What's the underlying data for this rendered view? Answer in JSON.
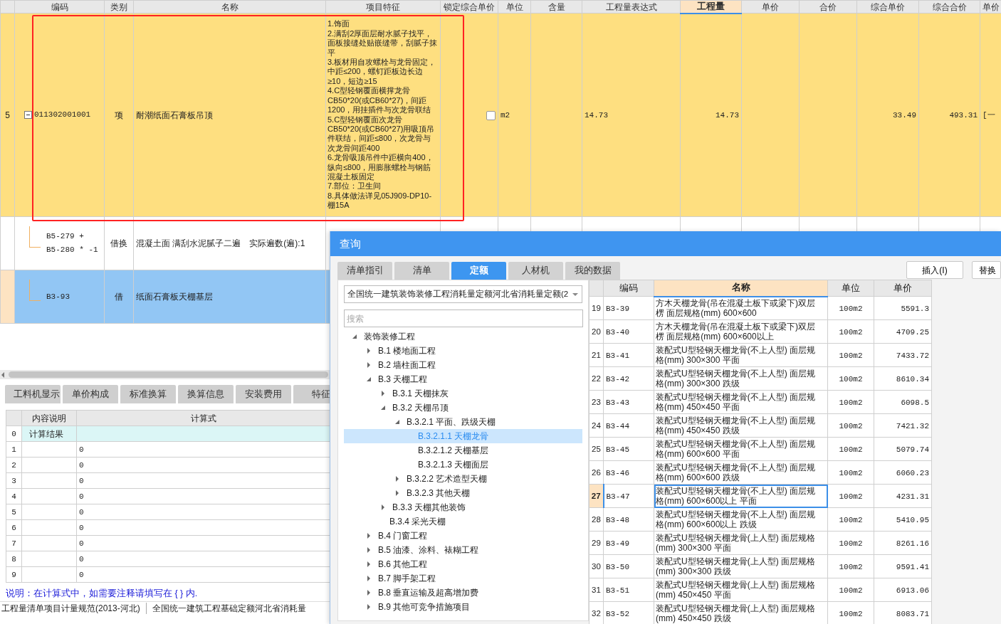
{
  "grid": {
    "columns": [
      {
        "label": "编码",
        "selected": false
      },
      {
        "label": "类别",
        "selected": false
      },
      {
        "label": "名称",
        "selected": false
      },
      {
        "label": "项目特征",
        "selected": false
      },
      {
        "label": "锁定综合单价",
        "selected": false
      },
      {
        "label": "单位",
        "selected": false
      },
      {
        "label": "含量",
        "selected": false
      },
      {
        "label": "工程量表达式",
        "selected": false
      },
      {
        "label": "工程量",
        "selected": true
      },
      {
        "label": "单价",
        "selected": false
      },
      {
        "label": "合价",
        "selected": false
      },
      {
        "label": "综合单价",
        "selected": false
      },
      {
        "label": "综合合价",
        "selected": false
      },
      {
        "label": "单价",
        "selected": false
      }
    ],
    "rows": [
      {
        "kind": "bill",
        "row_number": "5",
        "expanded": true,
        "selected": false,
        "code": [
          "011302001001"
        ],
        "category": "项",
        "name": "耐潮纸面石膏板吊顶",
        "features": [
          "1.饰面",
          "2.满刮2厚面层耐水腻子找平，面板接缝处贴嵌缝带，刮腻子抹平",
          "3.板材用自攻螺栓与龙骨固定，中距≤200，螺钉距板边长边≥10，短边≥15",
          "4.C型轻钢覆面横撑龙骨CB50*20(或CB60*27)，间距1200，用挂插件与次龙骨联结",
          "5.C型轻钢覆面次龙骨CB50*20(或CB60*27)用吸顶吊件联结，间距≤800，次龙骨与次龙骨间距400",
          "6.龙骨吸顶吊件中距横向400，纵向≤800，用膨胀螺栓与钢筋混凝土板固定",
          "7.部位：卫生间",
          "8.具体做法详见05J909-DP10-棚15A"
        ],
        "locked": false,
        "unit": "m2",
        "expression": "14.73",
        "quantity": "14.73",
        "comp_unit_price": "33.49",
        "comp_total": "493.31",
        "column_15": "[一"
      },
      {
        "kind": "quota",
        "selected": false,
        "code": [
          "B5-279 +",
          "B5-280 * -1"
        ],
        "category": "借换",
        "name": "混凝土面 满刮水泥腻子二遍　实际遍数(遍):1"
      },
      {
        "kind": "quota",
        "selected": true,
        "code": [
          "B3-93"
        ],
        "category": "借",
        "name": "纸面石膏板天棚基层"
      }
    ]
  },
  "bottom_tabs": [
    {
      "label": "工料机显示"
    },
    {
      "label": "单价构成"
    },
    {
      "label": "标准换算"
    },
    {
      "label": "换算信息"
    },
    {
      "label": "安装费用"
    },
    {
      "label": "特征"
    }
  ],
  "calc_table": {
    "columns": [
      "内容说明",
      "计算式"
    ],
    "rows": [
      {
        "index": "0",
        "description": "计算结果",
        "highlighted": true
      },
      {
        "index": "1",
        "formula": "0",
        "highlighted": false
      },
      {
        "index": "2",
        "formula": "0",
        "highlighted": false
      },
      {
        "index": "3",
        "formula": "0",
        "highlighted": false
      },
      {
        "index": "4",
        "formula": "0",
        "highlighted": false
      },
      {
        "index": "5",
        "formula": "0",
        "highlighted": false
      },
      {
        "index": "6",
        "formula": "0",
        "highlighted": false
      },
      {
        "index": "7",
        "formula": "0",
        "highlighted": false
      },
      {
        "index": "8",
        "formula": "0",
        "highlighted": false
      },
      {
        "index": "9",
        "formula": "0",
        "highlighted": false
      }
    ]
  },
  "note": "说明：在计算式中，如需要注释请填写在 { } 内.",
  "status_bar": [
    "工程量清单项目计量规范(2013-河北)",
    "全国统一建筑工程基础定额河北省消耗量"
  ],
  "dialog": {
    "title": "查询",
    "tabs": [
      {
        "label": "清单指引",
        "selected": false
      },
      {
        "label": "清单",
        "selected": false
      },
      {
        "label": "定额",
        "selected": true
      },
      {
        "label": "人材机",
        "selected": false
      },
      {
        "label": "我的数据",
        "selected": false
      }
    ],
    "buttons": [
      "插入(I)",
      "替换"
    ],
    "library": "全国统一建筑装饰装修工程消耗量定额河北省消耗量定额(2",
    "search": {
      "placeholder": "搜索"
    },
    "tree": [
      {
        "label": "装饰装修工程",
        "expanded": true,
        "selected": false,
        "children": [
          {
            "label": "B.1 楼地面工程",
            "expanded": false,
            "selected": false
          },
          {
            "label": "B.2 墙柱面工程",
            "expanded": false,
            "selected": false
          },
          {
            "label": "B.3 天棚工程",
            "expanded": true,
            "selected": false,
            "children": [
              {
                "label": "B.3.1 天棚抹灰",
                "expanded": false,
                "selected": false
              },
              {
                "label": "B.3.2 天棚吊顶",
                "expanded": true,
                "selected": false,
                "children": [
                  {
                    "label": "B.3.2.1 平面、跌级天棚",
                    "expanded": true,
                    "selected": false,
                    "children": [
                      {
                        "label": "B.3.2.1.1 天棚龙骨",
                        "selected": true
                      },
                      {
                        "label": "B.3.2.1.2 天棚基层",
                        "selected": false
                      },
                      {
                        "label": "B.3.2.1.3 天棚面层",
                        "selected": false
                      }
                    ]
                  },
                  {
                    "label": "B.3.2.2 艺术造型天棚",
                    "expanded": false,
                    "selected": false
                  },
                  {
                    "label": "B.3.2.3 其他天棚",
                    "expanded": false,
                    "selected": false
                  }
                ]
              },
              {
                "label": "B.3.3 天棚其他装饰",
                "expanded": false,
                "selected": false
              },
              {
                "label": "B.3.4 采光天棚",
                "selected": false
              }
            ]
          },
          {
            "label": "B.4 门窗工程",
            "expanded": false,
            "selected": false
          },
          {
            "label": "B.5 油漆、涂料、裱糊工程",
            "expanded": false,
            "selected": false
          },
          {
            "label": "B.6 其他工程",
            "expanded": false,
            "selected": false
          },
          {
            "label": "B.7 脚手架工程",
            "expanded": false,
            "selected": false
          },
          {
            "label": "B.8 垂直运输及超高增加费",
            "expanded": false,
            "selected": false
          },
          {
            "label": "B.9 其他可竞争措施项目",
            "expanded": false,
            "selected": false
          }
        ]
      }
    ],
    "quota_table": {
      "columns": [
        {
          "label": "编码",
          "selected": false
        },
        {
          "label": "名称",
          "selected": true
        },
        {
          "label": "单位",
          "selected": false
        },
        {
          "label": "单价",
          "selected": false
        }
      ],
      "rows": [
        {
          "index": "19",
          "code": "B3-39",
          "name": "方木天棚龙骨(吊在混凝土板下或梁下)双层楞 面层规格(mm) 600×600",
          "unit": "100m2",
          "price": "5591.3",
          "selected": false
        },
        {
          "index": "20",
          "code": "B3-40",
          "name": "方木天棚龙骨(吊在混凝土板下或梁下)双层楞 面层规格(mm) 600×600以上",
          "unit": "100m2",
          "price": "4709.25",
          "selected": false
        },
        {
          "index": "21",
          "code": "B3-41",
          "name": "装配式U型轻钢天棚龙骨(不上人型) 面层规格(mm) 300×300 平面",
          "unit": "100m2",
          "price": "7433.72",
          "selected": false
        },
        {
          "index": "22",
          "code": "B3-42",
          "name": "装配式U型轻钢天棚龙骨(不上人型) 面层规格(mm) 300×300 跌级",
          "unit": "100m2",
          "price": "8610.34",
          "selected": false
        },
        {
          "index": "23",
          "code": "B3-43",
          "name": "装配式U型轻钢天棚龙骨(不上人型) 面层规格(mm) 450×450 平面",
          "unit": "100m2",
          "price": "6098.5",
          "selected": false
        },
        {
          "index": "24",
          "code": "B3-44",
          "name": "装配式U型轻钢天棚龙骨(不上人型) 面层规格(mm) 450×450 跌级",
          "unit": "100m2",
          "price": "7421.32",
          "selected": false
        },
        {
          "index": "25",
          "code": "B3-45",
          "name": "装配式U型轻钢天棚龙骨(不上人型) 面层规格(mm) 600×600 平面",
          "unit": "100m2",
          "price": "5079.74",
          "selected": false
        },
        {
          "index": "26",
          "code": "B3-46",
          "name": "装配式U型轻钢天棚龙骨(不上人型) 面层规格(mm) 600×600 跌级",
          "unit": "100m2",
          "price": "6060.23",
          "selected": false
        },
        {
          "index": "27",
          "code": "B3-47",
          "name": "装配式U型轻钢天棚龙骨(不上人型) 面层规格(mm) 600×600以上 平面",
          "unit": "100m2",
          "price": "4231.31",
          "selected": true
        },
        {
          "index": "28",
          "code": "B3-48",
          "name": "装配式U型轻钢天棚龙骨(不上人型) 面层规格(mm) 600×600以上 跌级",
          "unit": "100m2",
          "price": "5410.95",
          "selected": false
        },
        {
          "index": "29",
          "code": "B3-49",
          "name": "装配式U型轻钢天棚龙骨(上人型) 面层规格(mm) 300×300 平面",
          "unit": "100m2",
          "price": "8261.16",
          "selected": false
        },
        {
          "index": "30",
          "code": "B3-50",
          "name": "装配式U型轻钢天棚龙骨(上人型) 面层规格(mm) 300×300 跌级",
          "unit": "100m2",
          "price": "9591.41",
          "selected": false
        },
        {
          "index": "31",
          "code": "B3-51",
          "name": "装配式U型轻钢天棚龙骨(上人型) 面层规格(mm) 450×450 平面",
          "unit": "100m2",
          "price": "6913.06",
          "selected": false
        },
        {
          "index": "32",
          "code": "B3-52",
          "name": "装配式U型轻钢天棚龙骨(上人型) 面层规格(mm) 450×450 跌级",
          "unit": "100m2",
          "price": "8083.71",
          "selected": false
        }
      ]
    }
  }
}
